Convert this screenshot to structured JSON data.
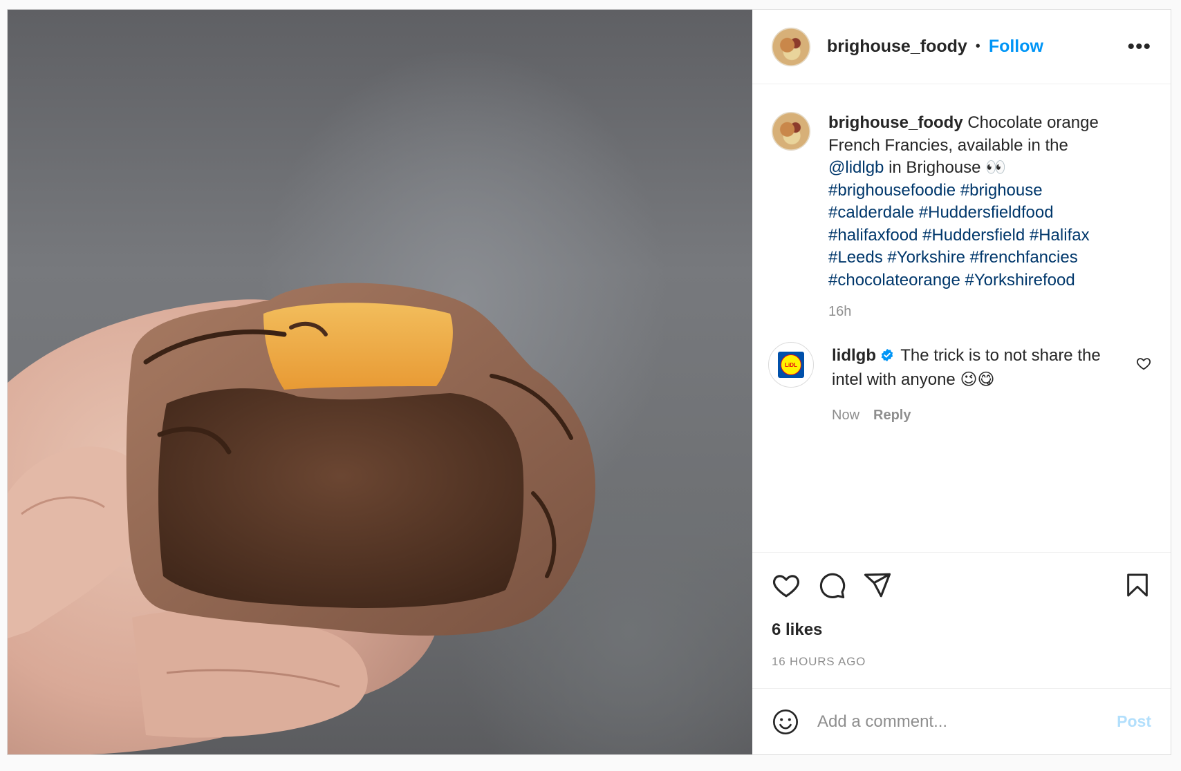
{
  "header": {
    "username": "brighouse_foody",
    "separator": "•",
    "follow_label": "Follow",
    "more_label": "•••"
  },
  "caption": {
    "username": "brighouse_foody",
    "text_1": " Chocolate orange French Francies, available in the ",
    "mention": "@lidlgb",
    "text_2": " in Brighouse 👀 ",
    "hashtags": [
      "#brighousefoodie",
      "#brighouse",
      "#calderdale",
      "#Huddersfieldfood",
      "#halifaxfood",
      "#Huddersfield",
      "#Halifax",
      "#Leeds",
      "#Yorkshire",
      "#frenchfancies",
      "#chocolateorange",
      "#Yorkshirefood"
    ],
    "time": "16h"
  },
  "comment": {
    "username": "lidlgb",
    "avatar_text": "LiDL",
    "text": " The trick is to not share the intel with anyone 😉😋",
    "time": "Now",
    "reply_label": "Reply"
  },
  "actions": {
    "icons": [
      "heart-icon",
      "comment-icon",
      "share-icon",
      "bookmark-icon"
    ]
  },
  "likes": "6 likes",
  "posted_ago": "16 HOURS AGO",
  "add_comment": {
    "placeholder": "Add a comment...",
    "post_label": "Post"
  },
  "colors": {
    "accent": "#0095f6",
    "link": "#00376b",
    "muted": "#8e8e8e",
    "post_disabled": "#b2dffc"
  }
}
